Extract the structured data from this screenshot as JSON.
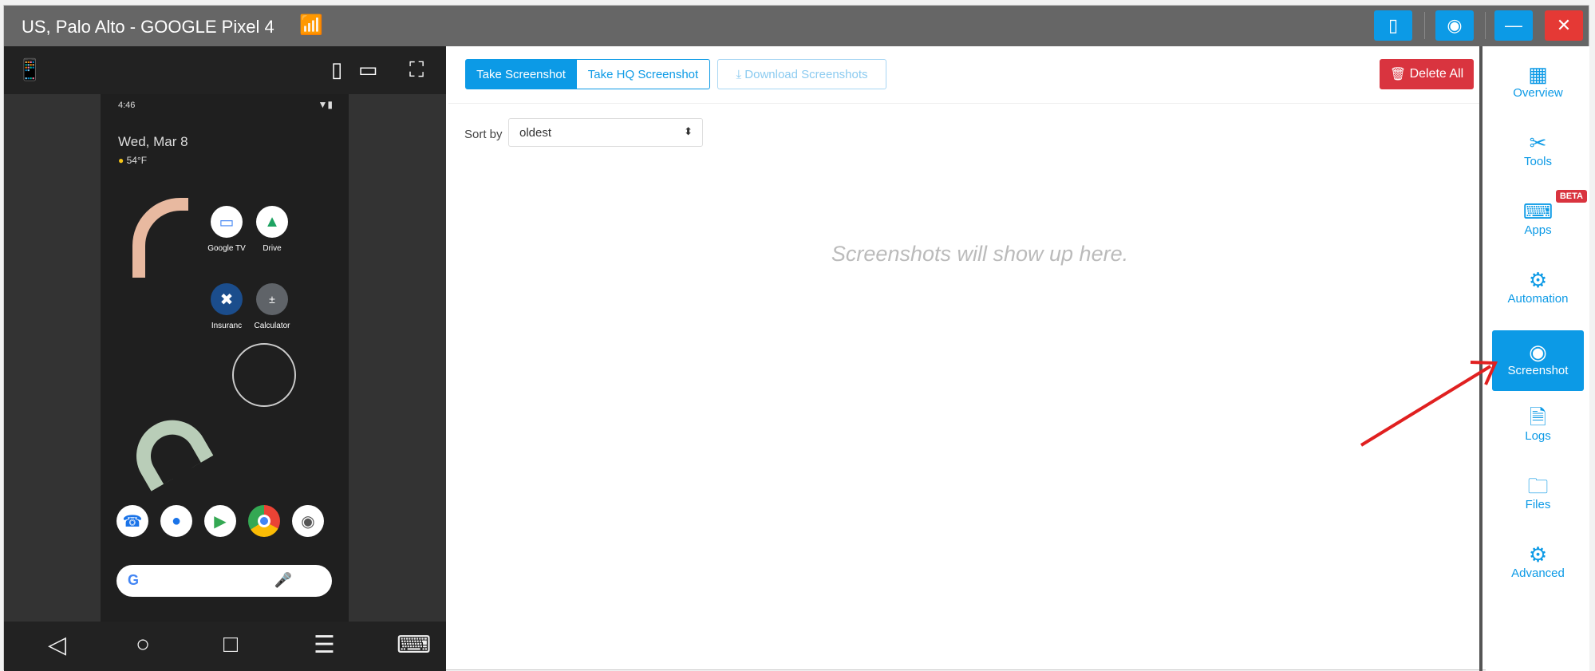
{
  "window": {
    "title": "US, Palo Alto - GOOGLE Pixel 4"
  },
  "phone": {
    "status_time": "4:46",
    "date": "Wed, Mar 8",
    "weather": "54°F",
    "apps": [
      "Google TV",
      "Drive",
      "Insuranc",
      "Calculator"
    ]
  },
  "toolbar": {
    "take_screenshot": "Take Screenshot",
    "take_hq": "Take HQ Screenshot",
    "download": "Download Screenshots",
    "delete_all": "Delete All"
  },
  "sort": {
    "label": "Sort by",
    "value": "oldest"
  },
  "empty_message": "Screenshots will show up here.",
  "sidebar": {
    "items": [
      {
        "label": "Overview"
      },
      {
        "label": "Tools"
      },
      {
        "label": "Apps",
        "badge": "BETA"
      },
      {
        "label": "Automation"
      },
      {
        "label": "Screenshot",
        "active": true
      },
      {
        "label": "Logs"
      },
      {
        "label": "Files"
      },
      {
        "label": "Advanced"
      }
    ]
  },
  "colors": {
    "accent": "#0c9ae6",
    "danger": "#d9343f",
    "annotation_arrow": "#e02020"
  }
}
